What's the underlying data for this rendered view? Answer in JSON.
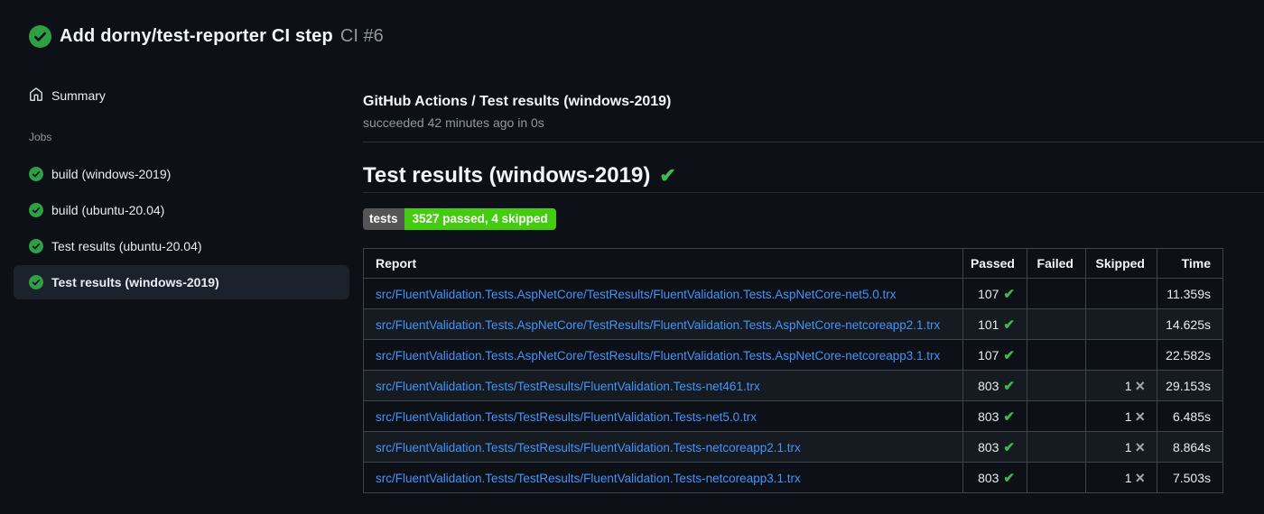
{
  "run_header": {
    "title": "Add dorny/test-reporter CI step",
    "run_number": "CI #6"
  },
  "sidebar": {
    "summary_label": "Summary",
    "jobs_label": "Jobs",
    "jobs": [
      {
        "label": "build (windows-2019)",
        "selected": false
      },
      {
        "label": "build (ubuntu-20.04)",
        "selected": false
      },
      {
        "label": "Test results (ubuntu-20.04)",
        "selected": false
      },
      {
        "label": "Test results (windows-2019)",
        "selected": true
      }
    ]
  },
  "main": {
    "job_title": "GitHub Actions / Test results (windows-2019)",
    "job_status_line": "succeeded 42 minutes ago in 0s",
    "section_heading": "Test results (windows-2019)",
    "badge": {
      "label": "tests",
      "value": "3527 passed, 4 skipped"
    },
    "table": {
      "columns": [
        "Report",
        "Passed",
        "Failed",
        "Skipped",
        "Time"
      ],
      "rows": [
        {
          "report": "src/FluentValidation.Tests.AspNetCore/TestResults/FluentValidation.Tests.AspNetCore-net5.0.trx",
          "passed": "107",
          "failed": "",
          "skipped": "",
          "time": "11.359s"
        },
        {
          "report": "src/FluentValidation.Tests.AspNetCore/TestResults/FluentValidation.Tests.AspNetCore-netcoreapp2.1.trx",
          "passed": "101",
          "failed": "",
          "skipped": "",
          "time": "14.625s"
        },
        {
          "report": "src/FluentValidation.Tests.AspNetCore/TestResults/FluentValidation.Tests.AspNetCore-netcoreapp3.1.trx",
          "passed": "107",
          "failed": "",
          "skipped": "",
          "time": "22.582s"
        },
        {
          "report": "src/FluentValidation.Tests/TestResults/FluentValidation.Tests-net461.trx",
          "passed": "803",
          "failed": "",
          "skipped": "1",
          "time": "29.153s"
        },
        {
          "report": "src/FluentValidation.Tests/TestResults/FluentValidation.Tests-net5.0.trx",
          "passed": "803",
          "failed": "",
          "skipped": "1",
          "time": "6.485s"
        },
        {
          "report": "src/FluentValidation.Tests/TestResults/FluentValidation.Tests-netcoreapp2.1.trx",
          "passed": "803",
          "failed": "",
          "skipped": "1",
          "time": "8.864s"
        },
        {
          "report": "src/FluentValidation.Tests/TestResults/FluentValidation.Tests-netcoreapp3.1.trx",
          "passed": "803",
          "failed": "",
          "skipped": "1",
          "time": "7.503s"
        }
      ]
    }
  },
  "colors": {
    "page_bg": "#0d1117",
    "success_green": "#2ea043",
    "check_green": "#3fb950",
    "link_blue": "#4493f8",
    "badge_label_bg": "#555555",
    "badge_value_bg": "#44cc11",
    "muted_text": "#9198a1",
    "selected_item_bg": "#1c222b",
    "table_border": "#3d444d"
  },
  "icons": {
    "run_status": "check-circle-icon",
    "summary": "home-icon",
    "job_status": "check-circle-icon",
    "passed": "check-icon",
    "skipped": "x-icon"
  }
}
